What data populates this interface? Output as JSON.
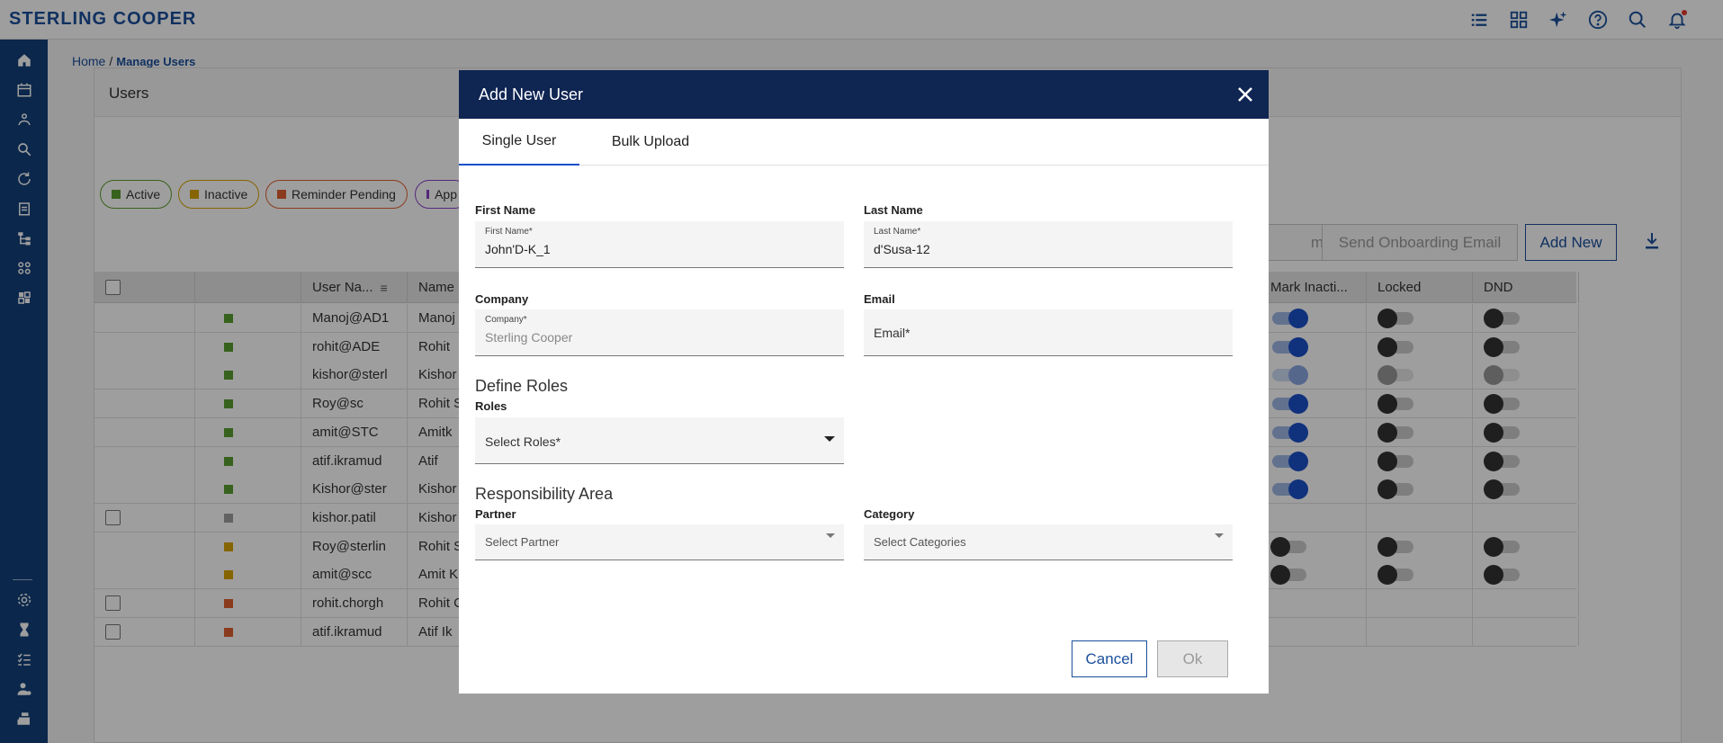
{
  "app": {
    "brand": "STERLING COOPER",
    "top_icons": [
      "list-icon",
      "dashboard-icon",
      "sparkle-icon",
      "help-icon",
      "search-icon",
      "bell-icon"
    ]
  },
  "breadcrumb": {
    "home": "Home",
    "separator": "/",
    "current": "Manage Users"
  },
  "panel": {
    "title": "Users"
  },
  "filters": [
    {
      "label": "Active",
      "color": "#5a9e2f",
      "border": "#5a9e2f"
    },
    {
      "label": "Inactive",
      "color": "#d9a400",
      "border": "#d9a400"
    },
    {
      "label": "Reminder Pending",
      "color": "#e0602f",
      "border": "#e0602f"
    },
    {
      "label": "App",
      "color": "#8a3fc8",
      "border": "#8a3fc8"
    }
  ],
  "actions": {
    "email_partial": "mail",
    "send_onboarding": "Send Onboarding Email",
    "add_new": "Add New"
  },
  "table": {
    "columns": [
      "User Na...",
      "Name",
      "Mark Inacti...",
      "Locked",
      "DND"
    ],
    "rows": [
      {
        "user": "Manoj@AD1",
        "name": "Manoj",
        "status": "#5a9e2f",
        "checkbox": false,
        "mark": "on",
        "locked": "off",
        "dnd": "off"
      },
      {
        "user": "rohit@ADE",
        "name": "Rohit",
        "status": "#5a9e2f",
        "checkbox": false,
        "mark": "on",
        "locked": "off",
        "dnd": "off"
      },
      {
        "user": "kishor@sterl",
        "name": "Kishor",
        "status": "#5a9e2f",
        "checkbox": false,
        "mark": "on-dim",
        "locked": "off-dim",
        "dnd": "off-dim"
      },
      {
        "user": "Roy@sc",
        "name": "Rohit S",
        "status": "#5a9e2f",
        "checkbox": false,
        "mark": "on",
        "locked": "off",
        "dnd": "off"
      },
      {
        "user": "amit@STC",
        "name": "Amitk",
        "status": "#5a9e2f",
        "checkbox": false,
        "mark": "on",
        "locked": "off",
        "dnd": "off"
      },
      {
        "user": "atif.ikramud",
        "name": "Atif",
        "status": "#5a9e2f",
        "checkbox": false,
        "mark": "on",
        "locked": "off",
        "dnd": "off"
      },
      {
        "user": "Kishor@ster",
        "name": "Kishor",
        "status": "#5a9e2f",
        "checkbox": false,
        "mark": "on",
        "locked": "off",
        "dnd": "off"
      },
      {
        "user": "kishor.patil",
        "name": "Kishor",
        "status": "#9e9e9e",
        "checkbox": true,
        "mark": "none",
        "locked": "none",
        "dnd": "none"
      },
      {
        "user": "Roy@sterlin",
        "name": "Rohit S",
        "status": "#d9a400",
        "checkbox": false,
        "mark": "off",
        "locked": "off",
        "dnd": "off"
      },
      {
        "user": "amit@scc",
        "name": "Amit K",
        "status": "#d9a400",
        "checkbox": false,
        "mark": "off",
        "locked": "off",
        "dnd": "off"
      },
      {
        "user": "rohit.chorgh",
        "name": "Rohit C",
        "status": "#e0602f",
        "checkbox": true,
        "mark": "none",
        "locked": "none",
        "dnd": "none"
      },
      {
        "user": "atif.ikramud",
        "name": "Atif Ik",
        "status": "#e0602f",
        "checkbox": true,
        "mark": "none",
        "locked": "none",
        "dnd": "none"
      }
    ]
  },
  "modal": {
    "title": "Add New User",
    "tabs": [
      "Single User",
      "Bulk Upload"
    ],
    "first_name": {
      "label": "First Name",
      "mini": "First Name*",
      "value": "John'D-K_1"
    },
    "last_name": {
      "label": "Last Name",
      "mini": "Last Name*",
      "value": "d'Susa-12"
    },
    "company": {
      "label": "Company",
      "mini": "Company*",
      "value": "Sterling Cooper"
    },
    "email": {
      "label": "Email",
      "placeholder": "Email*"
    },
    "define_roles": "Define Roles",
    "roles": {
      "label": "Roles",
      "placeholder": "Select Roles*"
    },
    "responsibility": "Responsibility Area",
    "partner": {
      "label": "Partner",
      "placeholder": "Select Partner"
    },
    "category": {
      "label": "Category",
      "placeholder": "Select Categories"
    },
    "cancel": "Cancel",
    "ok": "Ok"
  }
}
